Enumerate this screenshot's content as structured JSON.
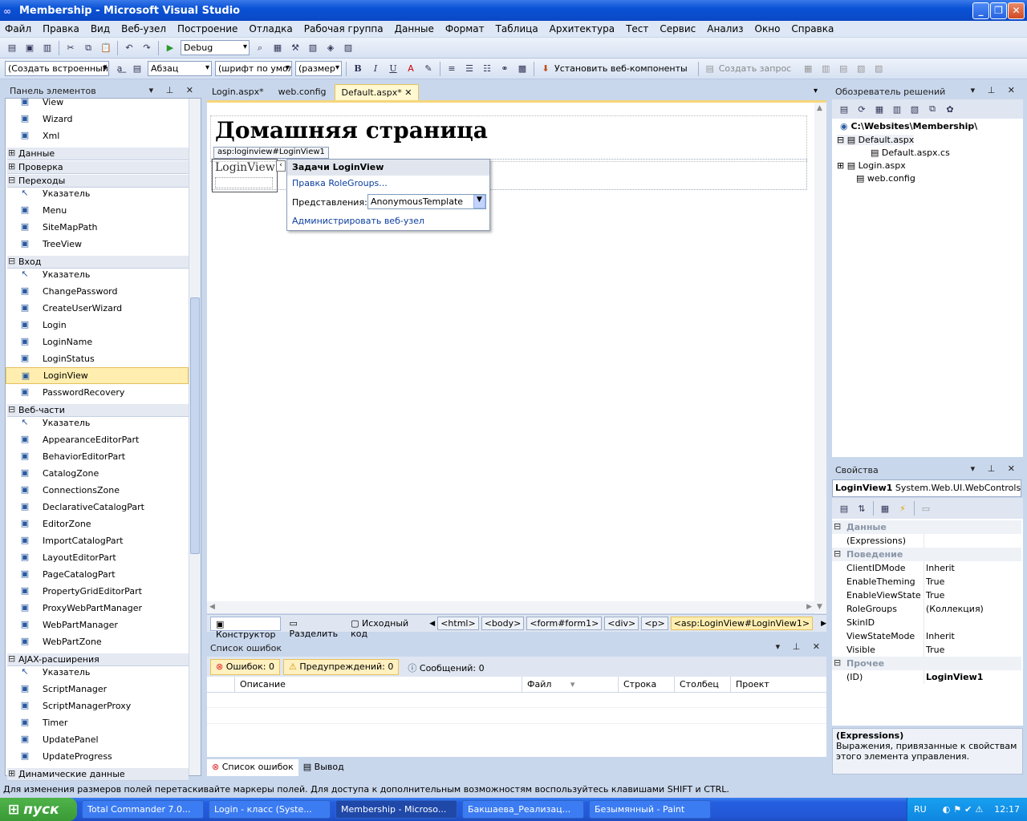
{
  "window": {
    "title": "Membership - Microsoft Visual Studio"
  },
  "menu": [
    "Файл",
    "Правка",
    "Вид",
    "Веб-узел",
    "Построение",
    "Отладка",
    "Рабочая группа",
    "Данные",
    "Формат",
    "Таблица",
    "Архитектура",
    "Тест",
    "Сервис",
    "Анализ",
    "Окно",
    "Справка"
  ],
  "toolbar1": {
    "config": "Debug"
  },
  "toolbar2": {
    "style": "(Создать встроенный",
    "block": "Абзац",
    "font": "(шрифт по умолча",
    "size": "(размер",
    "bold": "B",
    "italic": "I",
    "underline": "U",
    "install": "Установить веб-компоненты",
    "query": "Создать запрос"
  },
  "toolbox": {
    "title": "Панель элементов",
    "items": [
      {
        "type": "item",
        "label": "View",
        "icon": "view-icon"
      },
      {
        "type": "item",
        "label": "Wizard",
        "icon": "wizard-icon"
      },
      {
        "type": "item",
        "label": "Xml",
        "icon": "xml-icon"
      },
      {
        "type": "group",
        "label": "Данные",
        "closed": true
      },
      {
        "type": "group",
        "label": "Проверка",
        "closed": true
      },
      {
        "type": "group",
        "label": "Переходы"
      },
      {
        "type": "item",
        "label": "Указатель",
        "icon": "pointer-icon"
      },
      {
        "type": "item",
        "label": "Menu",
        "icon": "menu-icon"
      },
      {
        "type": "item",
        "label": "SiteMapPath",
        "icon": "sitemappath-icon"
      },
      {
        "type": "item",
        "label": "TreeView",
        "icon": "treeview-icon"
      },
      {
        "type": "group",
        "label": "Вход"
      },
      {
        "type": "item",
        "label": "Указатель",
        "icon": "pointer-icon"
      },
      {
        "type": "item",
        "label": "ChangePassword",
        "icon": "changepassword-icon"
      },
      {
        "type": "item",
        "label": "CreateUserWizard",
        "icon": "createuserwizard-icon"
      },
      {
        "type": "item",
        "label": "Login",
        "icon": "login-icon"
      },
      {
        "type": "item",
        "label": "LoginName",
        "icon": "loginname-icon"
      },
      {
        "type": "item",
        "label": "LoginStatus",
        "icon": "loginstatus-icon"
      },
      {
        "type": "item",
        "label": "LoginView",
        "icon": "loginview-icon",
        "selected": true
      },
      {
        "type": "item",
        "label": "PasswordRecovery",
        "icon": "passwordrecovery-icon"
      },
      {
        "type": "group",
        "label": "Веб-части"
      },
      {
        "type": "item",
        "label": "Указатель",
        "icon": "pointer-icon"
      },
      {
        "type": "item",
        "label": "AppearanceEditorPart",
        "icon": "appearance-icon"
      },
      {
        "type": "item",
        "label": "BehaviorEditorPart",
        "icon": "behavior-icon"
      },
      {
        "type": "item",
        "label": "CatalogZone",
        "icon": "catalogzone-icon"
      },
      {
        "type": "item",
        "label": "ConnectionsZone",
        "icon": "connectionszone-icon"
      },
      {
        "type": "item",
        "label": "DeclarativeCatalogPart",
        "icon": "declarative-icon"
      },
      {
        "type": "item",
        "label": "EditorZone",
        "icon": "editorzone-icon"
      },
      {
        "type": "item",
        "label": "ImportCatalogPart",
        "icon": "import-icon"
      },
      {
        "type": "item",
        "label": "LayoutEditorPart",
        "icon": "layout-icon"
      },
      {
        "type": "item",
        "label": "PageCatalogPart",
        "icon": "pagecatalog-icon"
      },
      {
        "type": "item",
        "label": "PropertyGridEditorPart",
        "icon": "propertygrid-icon"
      },
      {
        "type": "item",
        "label": "ProxyWebPartManager",
        "icon": "proxy-icon"
      },
      {
        "type": "item",
        "label": "WebPartManager",
        "icon": "webpartmanager-icon"
      },
      {
        "type": "item",
        "label": "WebPartZone",
        "icon": "webpartzone-icon"
      },
      {
        "type": "group",
        "label": "AJAX-расширения"
      },
      {
        "type": "item",
        "label": "Указатель",
        "icon": "pointer-icon"
      },
      {
        "type": "item",
        "label": "ScriptManager",
        "icon": "scriptmanager-icon"
      },
      {
        "type": "item",
        "label": "ScriptManagerProxy",
        "icon": "scriptmanagerproxy-icon"
      },
      {
        "type": "item",
        "label": "Timer",
        "icon": "timer-icon"
      },
      {
        "type": "item",
        "label": "UpdatePanel",
        "icon": "updatepanel-icon"
      },
      {
        "type": "item",
        "label": "UpdateProgress",
        "icon": "updateprogress-icon"
      },
      {
        "type": "group",
        "label": "Динамические данные",
        "closed": true
      }
    ]
  },
  "tabs": [
    {
      "label": "Login.aspx*"
    },
    {
      "label": "web.config"
    },
    {
      "label": "Default.aspx*",
      "active": true
    }
  ],
  "design": {
    "heading": "Домашняя страница",
    "control_tag": "asp:loginview#LoginView1",
    "control_label": "LoginView1"
  },
  "tasks": {
    "title": "Задачи LoginView",
    "edit_link": "Правка RoleGroups...",
    "view_label": "Представления:",
    "view_value": "AnonymousTemplate",
    "admin_link": "Администрировать веб-узел"
  },
  "designbar": {
    "designer": "Конструктор",
    "split": "Разделить",
    "source": "Исходный код",
    "crumbs": [
      "<html>",
      "<body>",
      "<form#form1>",
      "<div>",
      "<p>",
      "<asp:LoginView#LoginView1>"
    ]
  },
  "errors": {
    "title": "Список ошибок",
    "errors": "Ошибок: 0",
    "warnings": "Предупреждений: 0",
    "messages": "Сообщений: 0",
    "columns": [
      "Описание",
      "Файл",
      "Строка",
      "Столбец",
      "Проект"
    ],
    "tab_errors": "Список ошибок",
    "tab_output": "Вывод"
  },
  "solution": {
    "title": "Обозреватель решений",
    "root": "C:\\Websites\\Membership\\",
    "nodes": [
      "Default.aspx",
      "Default.aspx.cs",
      "Login.aspx",
      "web.config"
    ]
  },
  "properties": {
    "title": "Свойства",
    "object": "LoginView1",
    "object_type": "System.Web.UI.WebControls.LoginView",
    "categories": [
      {
        "name": "Данные",
        "rows": [
          [
            "(Expressions)",
            ""
          ]
        ]
      },
      {
        "name": "Поведение",
        "rows": [
          [
            "ClientIDMode",
            "Inherit"
          ],
          [
            "EnableTheming",
            "True"
          ],
          [
            "EnableViewState",
            "True"
          ],
          [
            "RoleGroups",
            "(Коллекция)"
          ],
          [
            "SkinID",
            ""
          ],
          [
            "ViewStateMode",
            "Inherit"
          ],
          [
            "Visible",
            "True"
          ]
        ]
      },
      {
        "name": "Прочее",
        "rows": [
          [
            "(ID)",
            "LoginView1"
          ]
        ]
      }
    ],
    "desc_title": "(Expressions)",
    "desc_text": "Выражения, привязанные к свойствам этого элемента управления."
  },
  "status": "Для изменения размеров полей перетаскивайте маркеры полей. Для доступа к дополнительным возможностям воспользуйтесь клавишами SHIFT и CTRL.",
  "taskbar": {
    "start": "пуск",
    "tasks": [
      {
        "label": "Total Commander 7.0..."
      },
      {
        "label": "Login - класс (Syste..."
      },
      {
        "label": "Membership - Microso...",
        "active": true
      },
      {
        "label": "Бакшаева_Реализац..."
      },
      {
        "label": "Безымянный - Paint"
      }
    ],
    "lang": "RU",
    "time": "12:17"
  },
  "colors": {
    "accent": "#f5d77b",
    "selection": "#ffeeb0",
    "link": "#0b3e9e"
  }
}
